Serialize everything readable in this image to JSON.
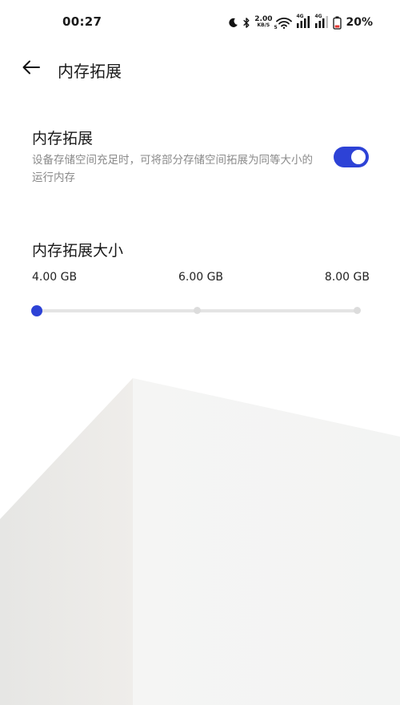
{
  "status_bar": {
    "time": "00:27",
    "net_speed_value": "2.00",
    "net_speed_unit": "KB/S",
    "sim1_tag": "4G",
    "sim2_tag": "4G",
    "wifi_tag": "5",
    "battery_percent": "20%",
    "icons": [
      "moon-icon",
      "bluetooth-icon",
      "wifi-icon",
      "signal-icon",
      "signal-icon",
      "battery-icon"
    ]
  },
  "header": {
    "back_icon": "arrow-left-icon",
    "title": "内存拓展"
  },
  "memory_expansion": {
    "title": "内存拓展",
    "description": "设备存储空间充足时，可将部分存储空间拓展为同等大小的运行内存",
    "enabled": true
  },
  "expansion_size": {
    "title": "内存拓展大小",
    "options": [
      "4.00 GB",
      "6.00 GB",
      "8.00 GB"
    ],
    "selected_index": 0
  },
  "colors": {
    "accent": "#2d42d6",
    "secondary_text": "#8a8a8a",
    "track": "#e4e4e4"
  }
}
